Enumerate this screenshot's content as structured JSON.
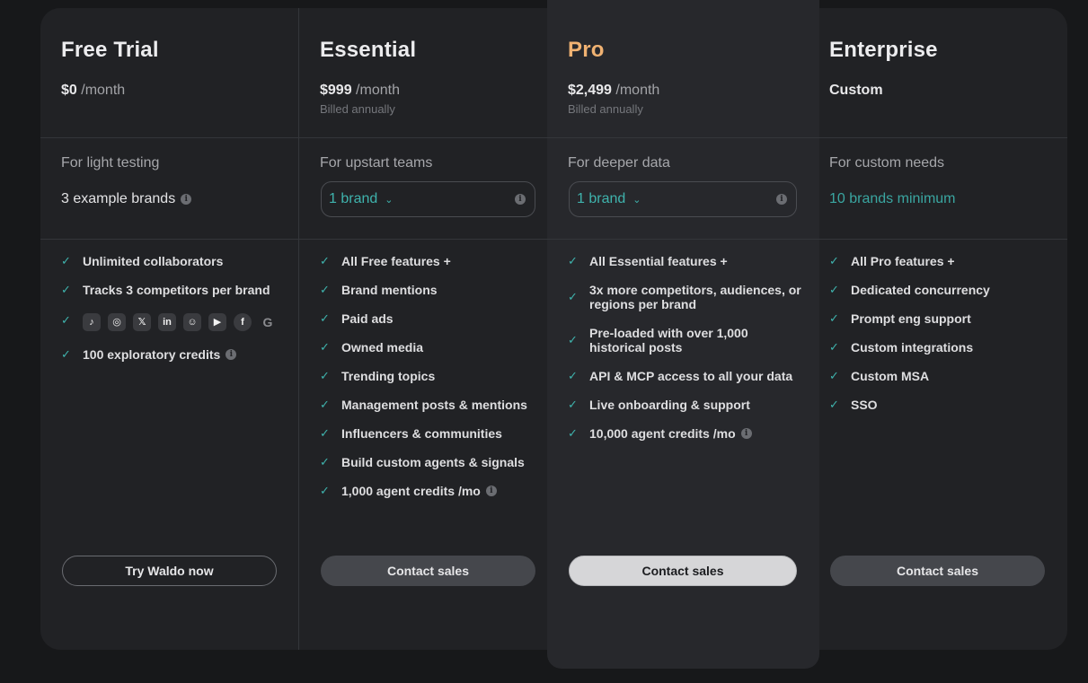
{
  "plans": [
    {
      "name": "Free Trial",
      "price": "$0",
      "period": "/month",
      "billed": "",
      "tagline": "For light testing",
      "brands": "3 example brands",
      "features": [
        "Unlimited collaborators",
        "Tracks 3 competitors per brand",
        "",
        "100 exploratory credits"
      ],
      "cta": "Try Waldo now"
    },
    {
      "name": "Essential",
      "price": "$999",
      "period": "/month",
      "billed": "Billed annually",
      "tagline": "For upstart teams",
      "brands": "1 brand",
      "features": [
        "All Free features +",
        "Brand mentions",
        "Paid ads",
        "Owned media",
        "Trending topics",
        "Management posts & mentions",
        "Influencers & communities",
        "Build custom agents & signals",
        "1,000 agent credits /mo"
      ],
      "cta": "Contact sales"
    },
    {
      "name": "Pro",
      "price": "$2,499",
      "period": "/month",
      "billed": "Billed annually",
      "tagline": "For deeper data",
      "brands": "1 brand",
      "features": [
        "All Essential features +",
        "3x more competitors, audiences, or regions per brand",
        "Pre-loaded with over 1,000 historical posts",
        "API & MCP access to all your data",
        "Live onboarding & support",
        "10,000 agent credits /mo"
      ],
      "cta": "Contact sales"
    },
    {
      "name": "Enterprise",
      "price": "Custom",
      "period": "",
      "billed": "",
      "tagline": "For custom needs",
      "brands": "10 brands minimum",
      "features": [
        "All Pro features +",
        "Dedicated concurrency",
        "Prompt eng support",
        "Custom integrations",
        "Custom MSA",
        "SSO"
      ],
      "cta": "Contact sales"
    }
  ],
  "social_icons": [
    "tiktok-icon",
    "instagram-icon",
    "x-icon",
    "linkedin-icon",
    "reddit-icon",
    "youtube-icon",
    "facebook-icon",
    "google-icon"
  ],
  "colors": {
    "background": "#17181a",
    "panel": "#212225",
    "pro_card": "#27282c",
    "accent_teal": "#3fb3ad",
    "pro_orange": "#f0b272"
  }
}
